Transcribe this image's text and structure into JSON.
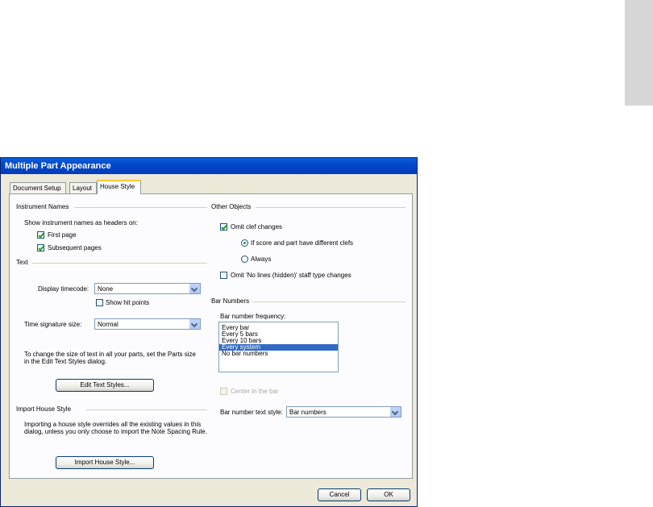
{
  "dialog": {
    "title": "Multiple Part Appearance",
    "tabs": [
      "Document Setup",
      "Layout",
      "House Style"
    ],
    "active_tab": "House Style"
  },
  "instrument_names": {
    "header": "Instrument Names",
    "prompt": "Show instrument names as headers on:",
    "first_page": "First page",
    "first_page_checked": true,
    "subsequent_pages": "Subsequent pages",
    "subsequent_pages_checked": true
  },
  "text": {
    "header": "Text",
    "display_timecode_label": "Display timecode:",
    "display_timecode_value": "None",
    "show_hit_points": "Show hit points",
    "show_hit_points_checked": false,
    "time_signature_label": "Time signature size:",
    "time_signature_value": "Normal",
    "info": "To change the size of text in all your parts, set the Parts size in the Edit Text Styles dialog.",
    "edit_text_styles_button": "Edit Text Styles..."
  },
  "import_house_style": {
    "header": "Import House Style",
    "info": "Importing a house style overrides all the existing values in this dialog, unless you only choose to import the Note Spacing Rule.",
    "button": "Import House Style..."
  },
  "other_objects": {
    "header": "Other Objects",
    "omit_clef_changes": "Omit clef changes",
    "omit_clef_changes_checked": true,
    "radio_different_clefs": "If score and part have different clefs",
    "radio_always": "Always",
    "selected_radio": "If score and part have different clefs",
    "omit_no_lines": "Omit 'No lines (hidden)' staff type changes",
    "omit_no_lines_checked": false
  },
  "bar_numbers": {
    "header": "Bar Numbers",
    "frequency_label": "Bar number frequency:",
    "frequency_options": [
      "Every bar",
      "Every 5 bars",
      "Every 10 bars",
      "Every system",
      "No bar numbers"
    ],
    "frequency_selected": "Every system",
    "center_in_bar": "Center in the bar",
    "center_in_bar_checked": false,
    "text_style_label": "Bar number text style:",
    "text_style_value": "Bar numbers"
  },
  "footer": {
    "cancel": "Cancel",
    "ok": "OK"
  }
}
